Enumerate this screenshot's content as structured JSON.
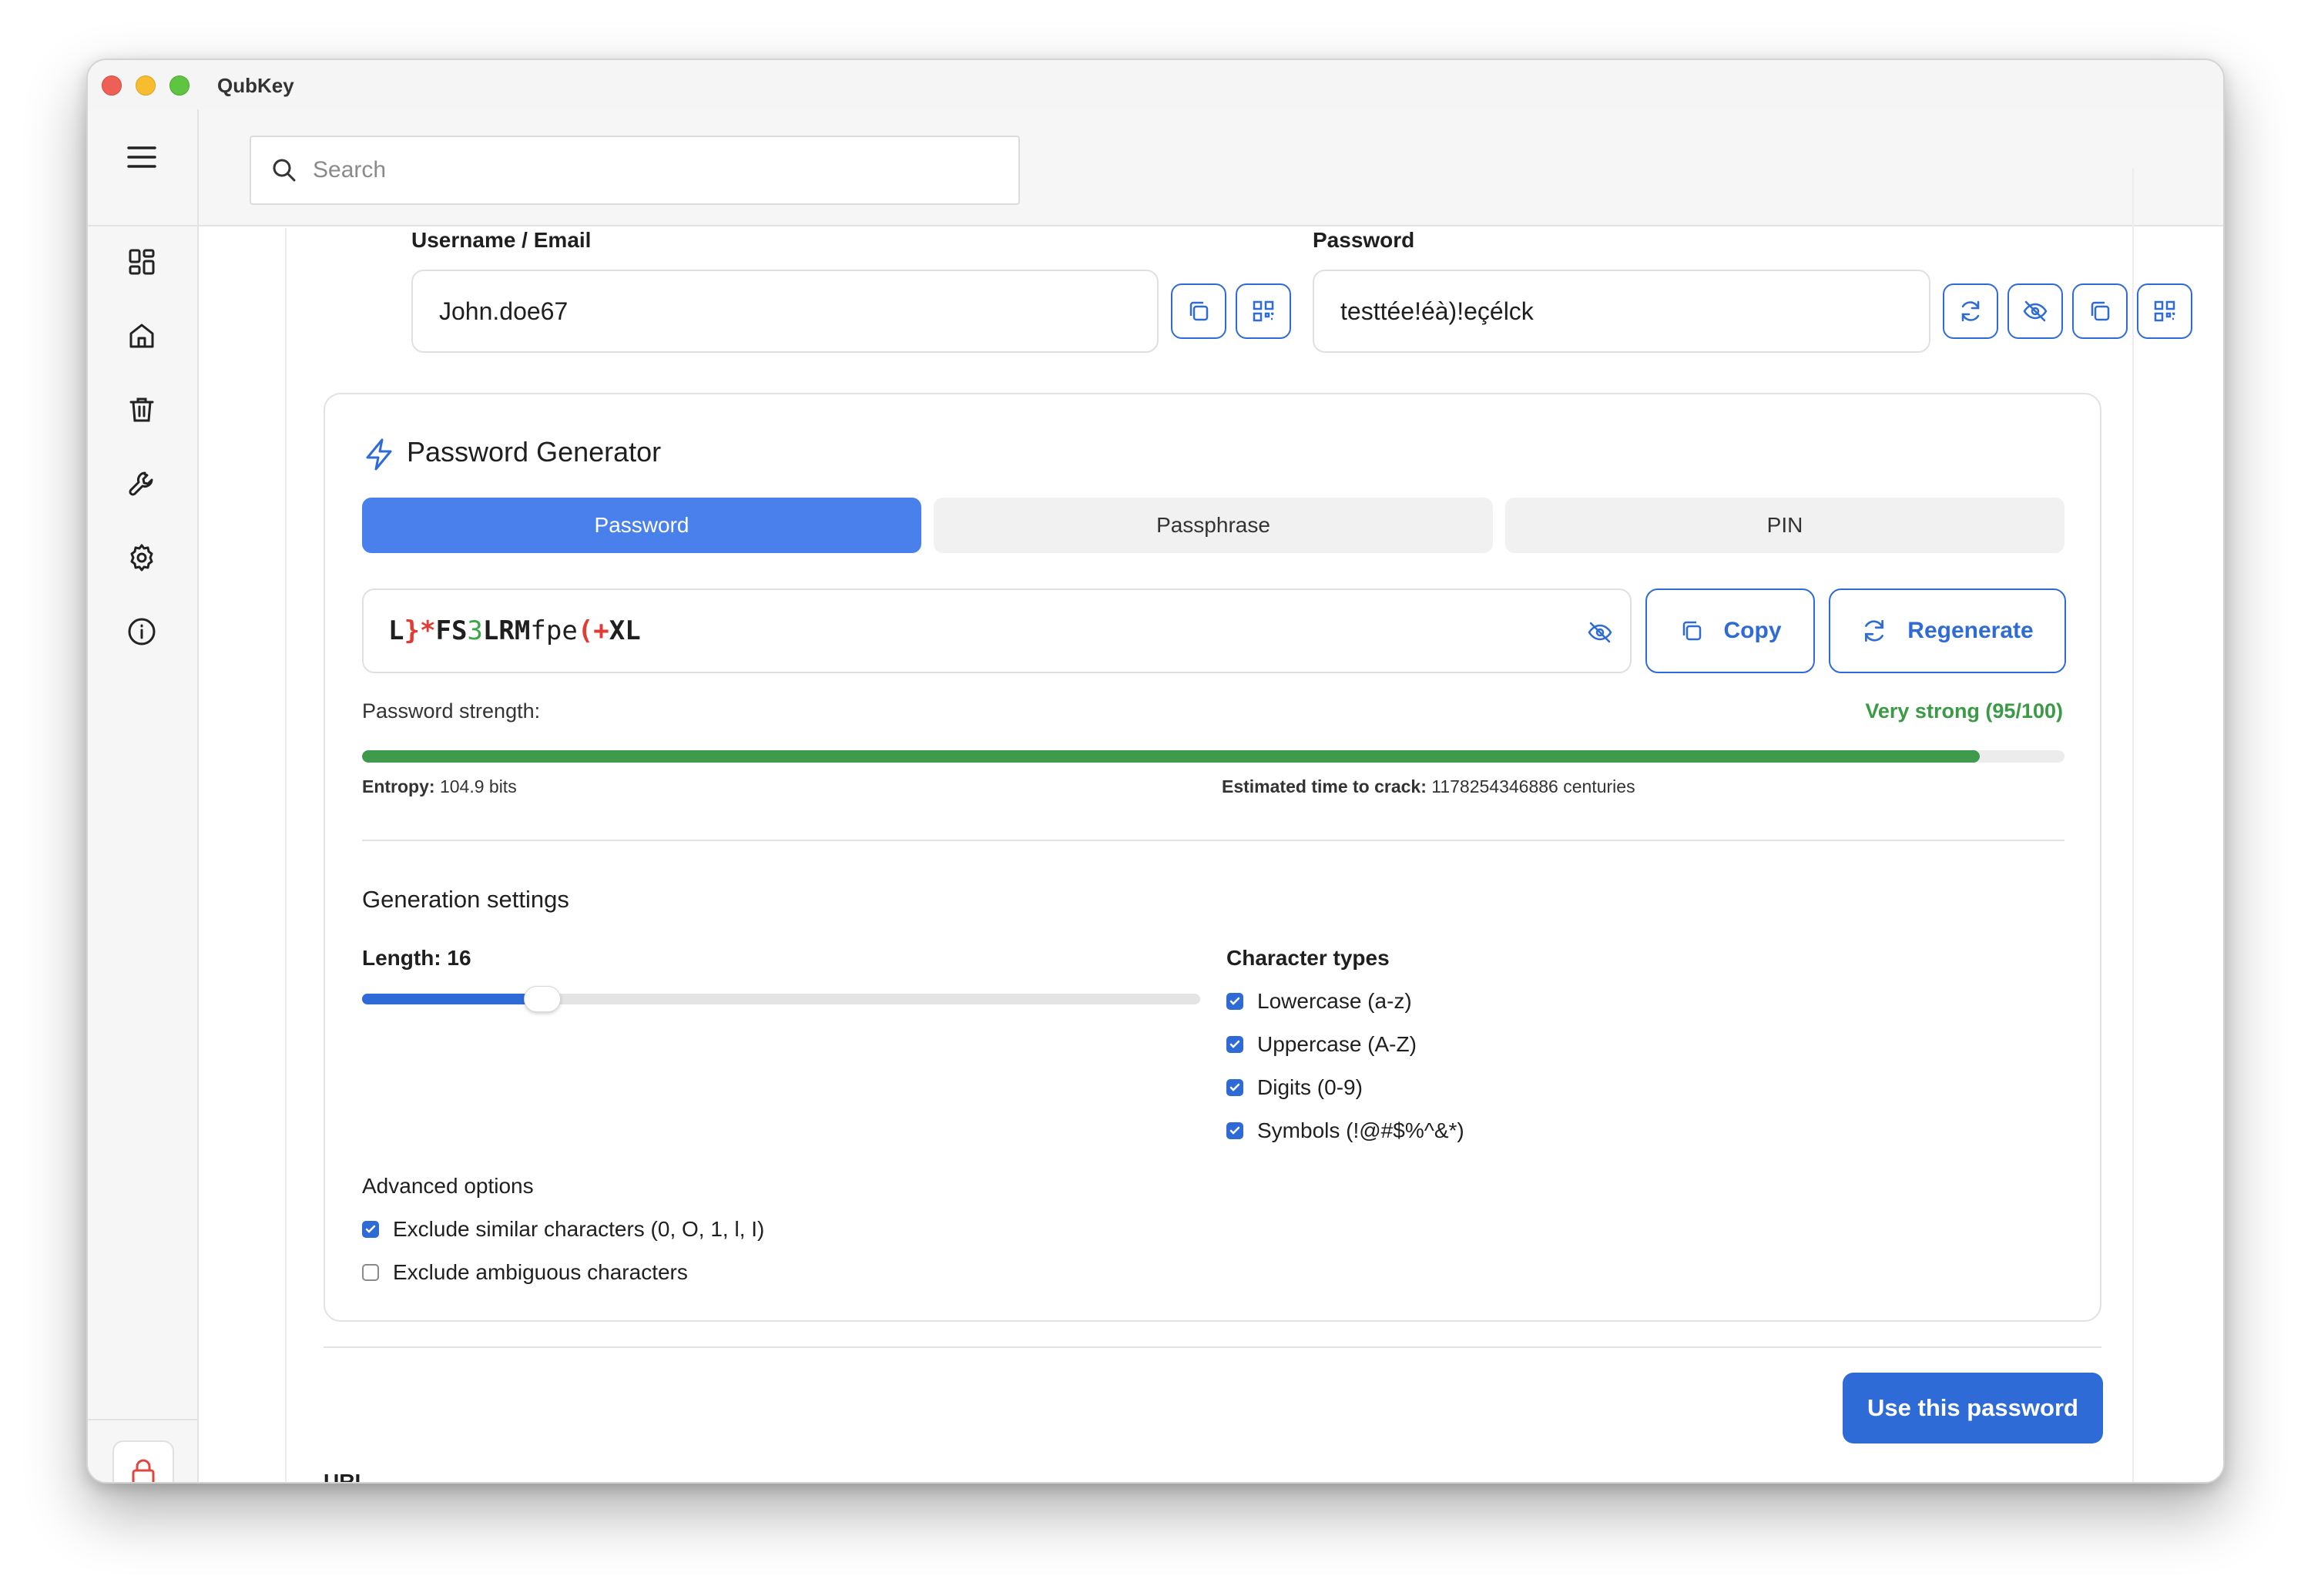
{
  "window": {
    "app_title": "QubKey"
  },
  "search": {
    "placeholder": "Search",
    "value": ""
  },
  "credentials": {
    "username_label": "Username / Email",
    "username_value": "John.doe67",
    "password_label": "Password",
    "password_value": "testtée!éà)!eçélck"
  },
  "generator": {
    "title": "Password Generator",
    "tabs": [
      {
        "label": "Password",
        "active": true
      },
      {
        "label": "Passphrase",
        "active": false
      },
      {
        "label": "PIN",
        "active": false
      }
    ],
    "generated_password": "L}*FS3LRMfpe(+XL",
    "copy_label": "Copy",
    "regenerate_label": "Regenerate",
    "strength_label": "Password strength:",
    "strength_value": "Very strong (95/100)",
    "strength_score": 95,
    "entropy_label": "Entropy:",
    "entropy_value": "104.9 bits",
    "crack_label": "Estimated time to crack:",
    "crack_value": "1178254346886 centuries",
    "settings_title": "Generation settings",
    "length_label": "Length: 16",
    "length_value": 16,
    "length_fraction": 0.215,
    "char_types_title": "Character types",
    "char_types": [
      {
        "label": "Lowercase (a-z)",
        "checked": true
      },
      {
        "label": "Uppercase (A-Z)",
        "checked": true
      },
      {
        "label": "Digits (0-9)",
        "checked": true
      },
      {
        "label": "Symbols (!@#$%^&*)",
        "checked": true
      }
    ],
    "advanced_title": "Advanced options",
    "advanced": [
      {
        "label": "Exclude similar characters (0, O, 1, l, I)",
        "checked": true
      },
      {
        "label": "Exclude ambiguous characters",
        "checked": false
      }
    ]
  },
  "use_password_label": "Use this password",
  "url_label": "URL",
  "colors": {
    "accent": "#2f6bd6",
    "tab_active": "#4a80ec",
    "strength": "#3f9a4b",
    "symbol": "#e03c35",
    "digit": "#3aa54a",
    "lock": "#e0463f"
  },
  "icons": [
    "menu-icon",
    "dashboard-icon",
    "home-icon",
    "trash-icon",
    "wrench-icon",
    "settings-icon",
    "info-icon",
    "lock-icon",
    "search-icon",
    "copy-icon",
    "qr-icon",
    "refresh-icon",
    "eye-off-icon",
    "bolt-icon"
  ]
}
